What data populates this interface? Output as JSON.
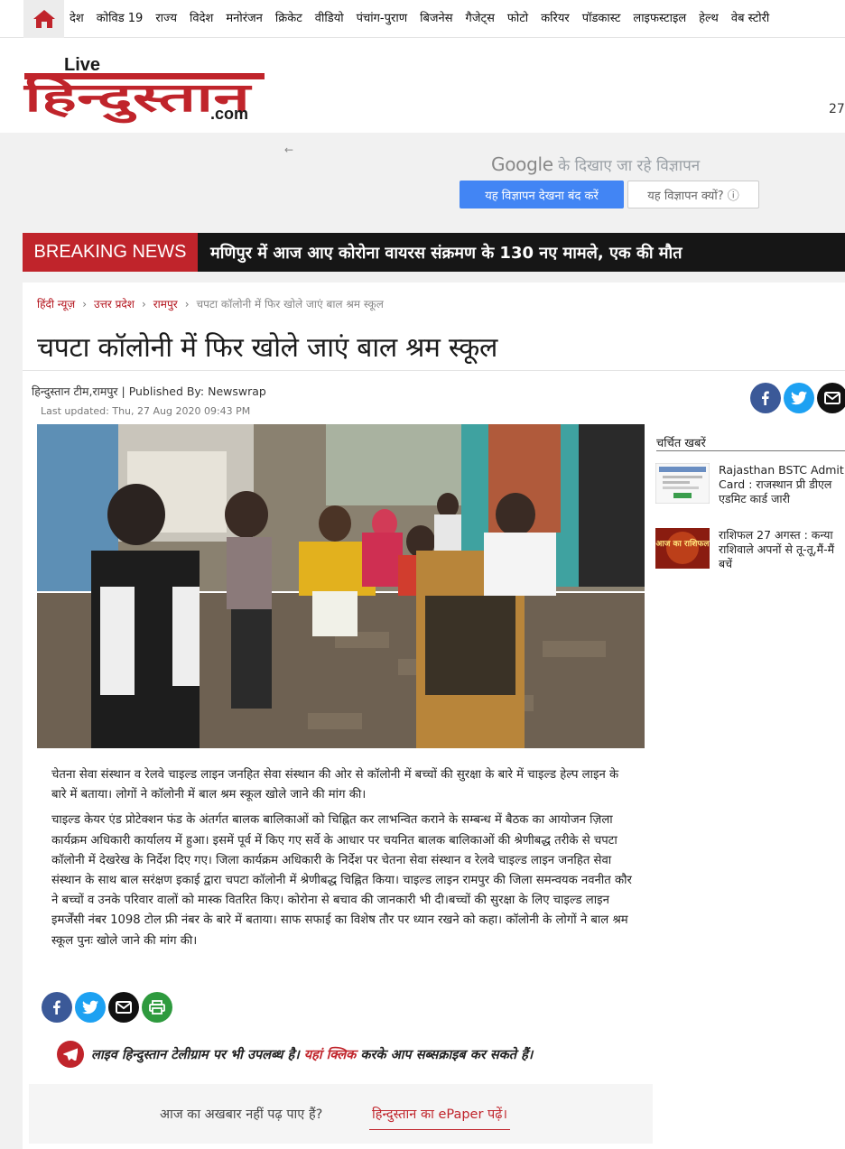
{
  "nav": {
    "items": [
      "देश",
      "कोविड 19",
      "राज्य",
      "विदेश",
      "मनोरंजन",
      "क्रिकेट",
      "वीडियो",
      "पंचांग-पुराण",
      "बिजनेस",
      "गैजेट्स",
      "फोटो",
      "करियर",
      "पॉडकास्ट",
      "लाइफस्टाइल",
      "हेल्थ",
      "वेब स्टोरी"
    ]
  },
  "header": {
    "logo_live": "Live",
    "logo_main": "हिन्दुस्तान",
    "logo_com": ".com",
    "date_partial": "27"
  },
  "ad": {
    "back": "←",
    "brand": "Google",
    "title_rest": " के दिखाए जा रहे विज्ञापन",
    "stop_label": "यह विज्ञापन देखना बंद करें",
    "why_label": "यह विज्ञापन क्यों? ⓘ"
  },
  "breaking": {
    "label": "BREAKING NEWS",
    "text": "मणिपुर में आज आए कोरोना वायरस संक्रमण के 130 नए मामले, एक की मौत"
  },
  "article": {
    "breadcrumbs": [
      "हिंदी न्यूज़",
      "उत्तर प्रदेश",
      "रामपुर"
    ],
    "breadcrumb_current": "चपटा कॉलोनी में फिर खोले जाएं बाल श्रम स्कूल",
    "breadcrumb_sep": "›",
    "title": "चपटा कॉलोनी में फिर खोले जाएं बाल श्रम स्कूल",
    "byline": "हिन्दुस्तान टीम,रामपुर    | Published By: Newswrap",
    "last_updated": "Last updated:  Thu, 27 Aug 2020 09:43 PM",
    "paragraphs": [
      "चेतना सेवा संस्थान व रेलवे चाइल्ड लाइन जनहित सेवा संस्थान की ओर से कॉलोनी में बच्चों की सुरक्षा के बारे में चाइल्ड हेल्प लाइन के बारे में बताया। लोगों ने कॉलोनी में बाल श्रम स्कूल खोले जाने की मांग की।",
      "चाइल्ड केयर एंड प्रोटेक्शन फंड के अंतर्गत बालक बालिकाओं को चिह्नित कर लाभन्वित कराने के सम्बन्ध में बैठक का आयोजन ज़िला कार्यक्रम अधिकारी कार्यालय में हुआ। इसमें पूर्व में किए गए सर्वे के आधार पर चयनित बालक बालिकाओं की श्रेणीबद्ध तरीके से चपटा कॉलोनी में देखरेख के निर्देश दिए गए। जिला कार्यक्रम अधिकारी के निर्देश पर चेतना सेवा संस्थान व रेलवे चाइल्ड लाइन जनहित सेवा संस्थान के साथ बाल सरंक्षण इकाई द्वारा चपटा कॉलोनी में श्रेणीबद्ध चिह्नित किया। चाइल्ड लाइन रामपुर की जिला समन्वयक नवनीत कौर ने बच्चों व उनके परिवार वालों को मास्क वितरित किए। कोरोना से बचाव की जानकारी भी दी।बच्चों की सुरक्षा के लिए चाइल्ड लाइन इमर्जेंसी नंबर 1098 टोल फ्री नंबर के बारे में बताया। साफ सफाई का विशेष तौर पर ध्यान रखने को कहा। कॉलोनी के लोगों ने बाल श्रम स्कूल पुनः खोले जाने की मांग की।"
    ]
  },
  "telegram": {
    "before": "लाइव हिन्दुस्तान टेलीग्राम पर भी उपलब्ध है। ",
    "link": "यहां क्लिक",
    "after": " करके आप सब्सक्राइब कर सकते हैं।"
  },
  "epaper": {
    "question": "आज का अखबार नहीं पढ़ पाए हैं?",
    "link": "हिन्दुस्तान का ePaper पढ़ें।"
  },
  "sidebar": {
    "title": "चर्चित खबरें",
    "items": [
      {
        "line1": "Rajasthan BSTC Admit",
        "line2": "Card : राजस्थान प्री डीएल",
        "line3": "एडमिट कार्ड जारी"
      },
      {
        "line1": "राशिफल 27 अगस्त : कन्या",
        "line2": "राशिवाले अपनों से तू-तू,मैं-मैं",
        "line3": "बचें",
        "thumb_text": "आज का राशिफल"
      }
    ]
  },
  "colors": {
    "brand_red": "#c0242b",
    "google_blue": "#4285f4",
    "breaking_bg": "#161616"
  }
}
